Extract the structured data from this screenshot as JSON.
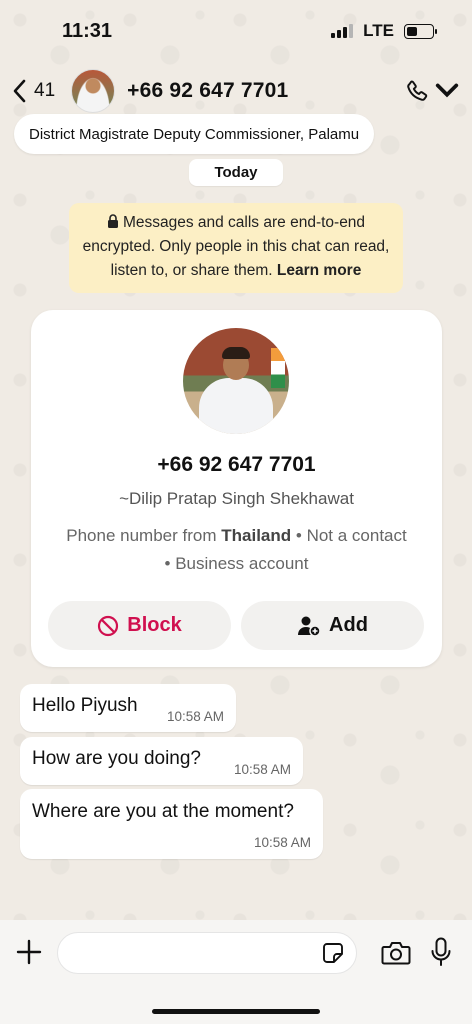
{
  "status_bar": {
    "time": "11:31",
    "network": "LTE"
  },
  "header": {
    "back_count": "41",
    "phone": "+66 92 647 7701",
    "subtitle": "District Magistrate Deputy Commissioner, Palamu"
  },
  "date_label": "Today",
  "encryption": {
    "text": "Messages and calls are end-to-end encrypted. Only people in this chat can read, listen to, or share them.",
    "link": "Learn more"
  },
  "contact_card": {
    "phone": "+66 92 647 7701",
    "name": "~Dilip Pratap Singh Shekhawat",
    "info_prefix": "Phone number from",
    "country": "Thailand",
    "info_suffix": "• Not a contact • Business account",
    "block_label": "Block",
    "add_label": "Add"
  },
  "messages": [
    {
      "text": "Hello Piyush",
      "time": "10:58 AM"
    },
    {
      "text": "How are you doing?",
      "time": "10:58 AM"
    },
    {
      "text": "Where are you at the moment?",
      "time": "10:58 AM"
    }
  ],
  "input": {
    "placeholder": ""
  },
  "colors": {
    "block": "#d0104f",
    "encryption_bg": "#fcefc5",
    "wallpaper": "#efeae2"
  },
  "icons": [
    "back-chevron-icon",
    "phone-icon",
    "chevron-down-icon",
    "lock-icon",
    "block-icon",
    "add-contact-icon",
    "plus-icon",
    "sticker-icon",
    "camera-icon",
    "mic-icon"
  ]
}
